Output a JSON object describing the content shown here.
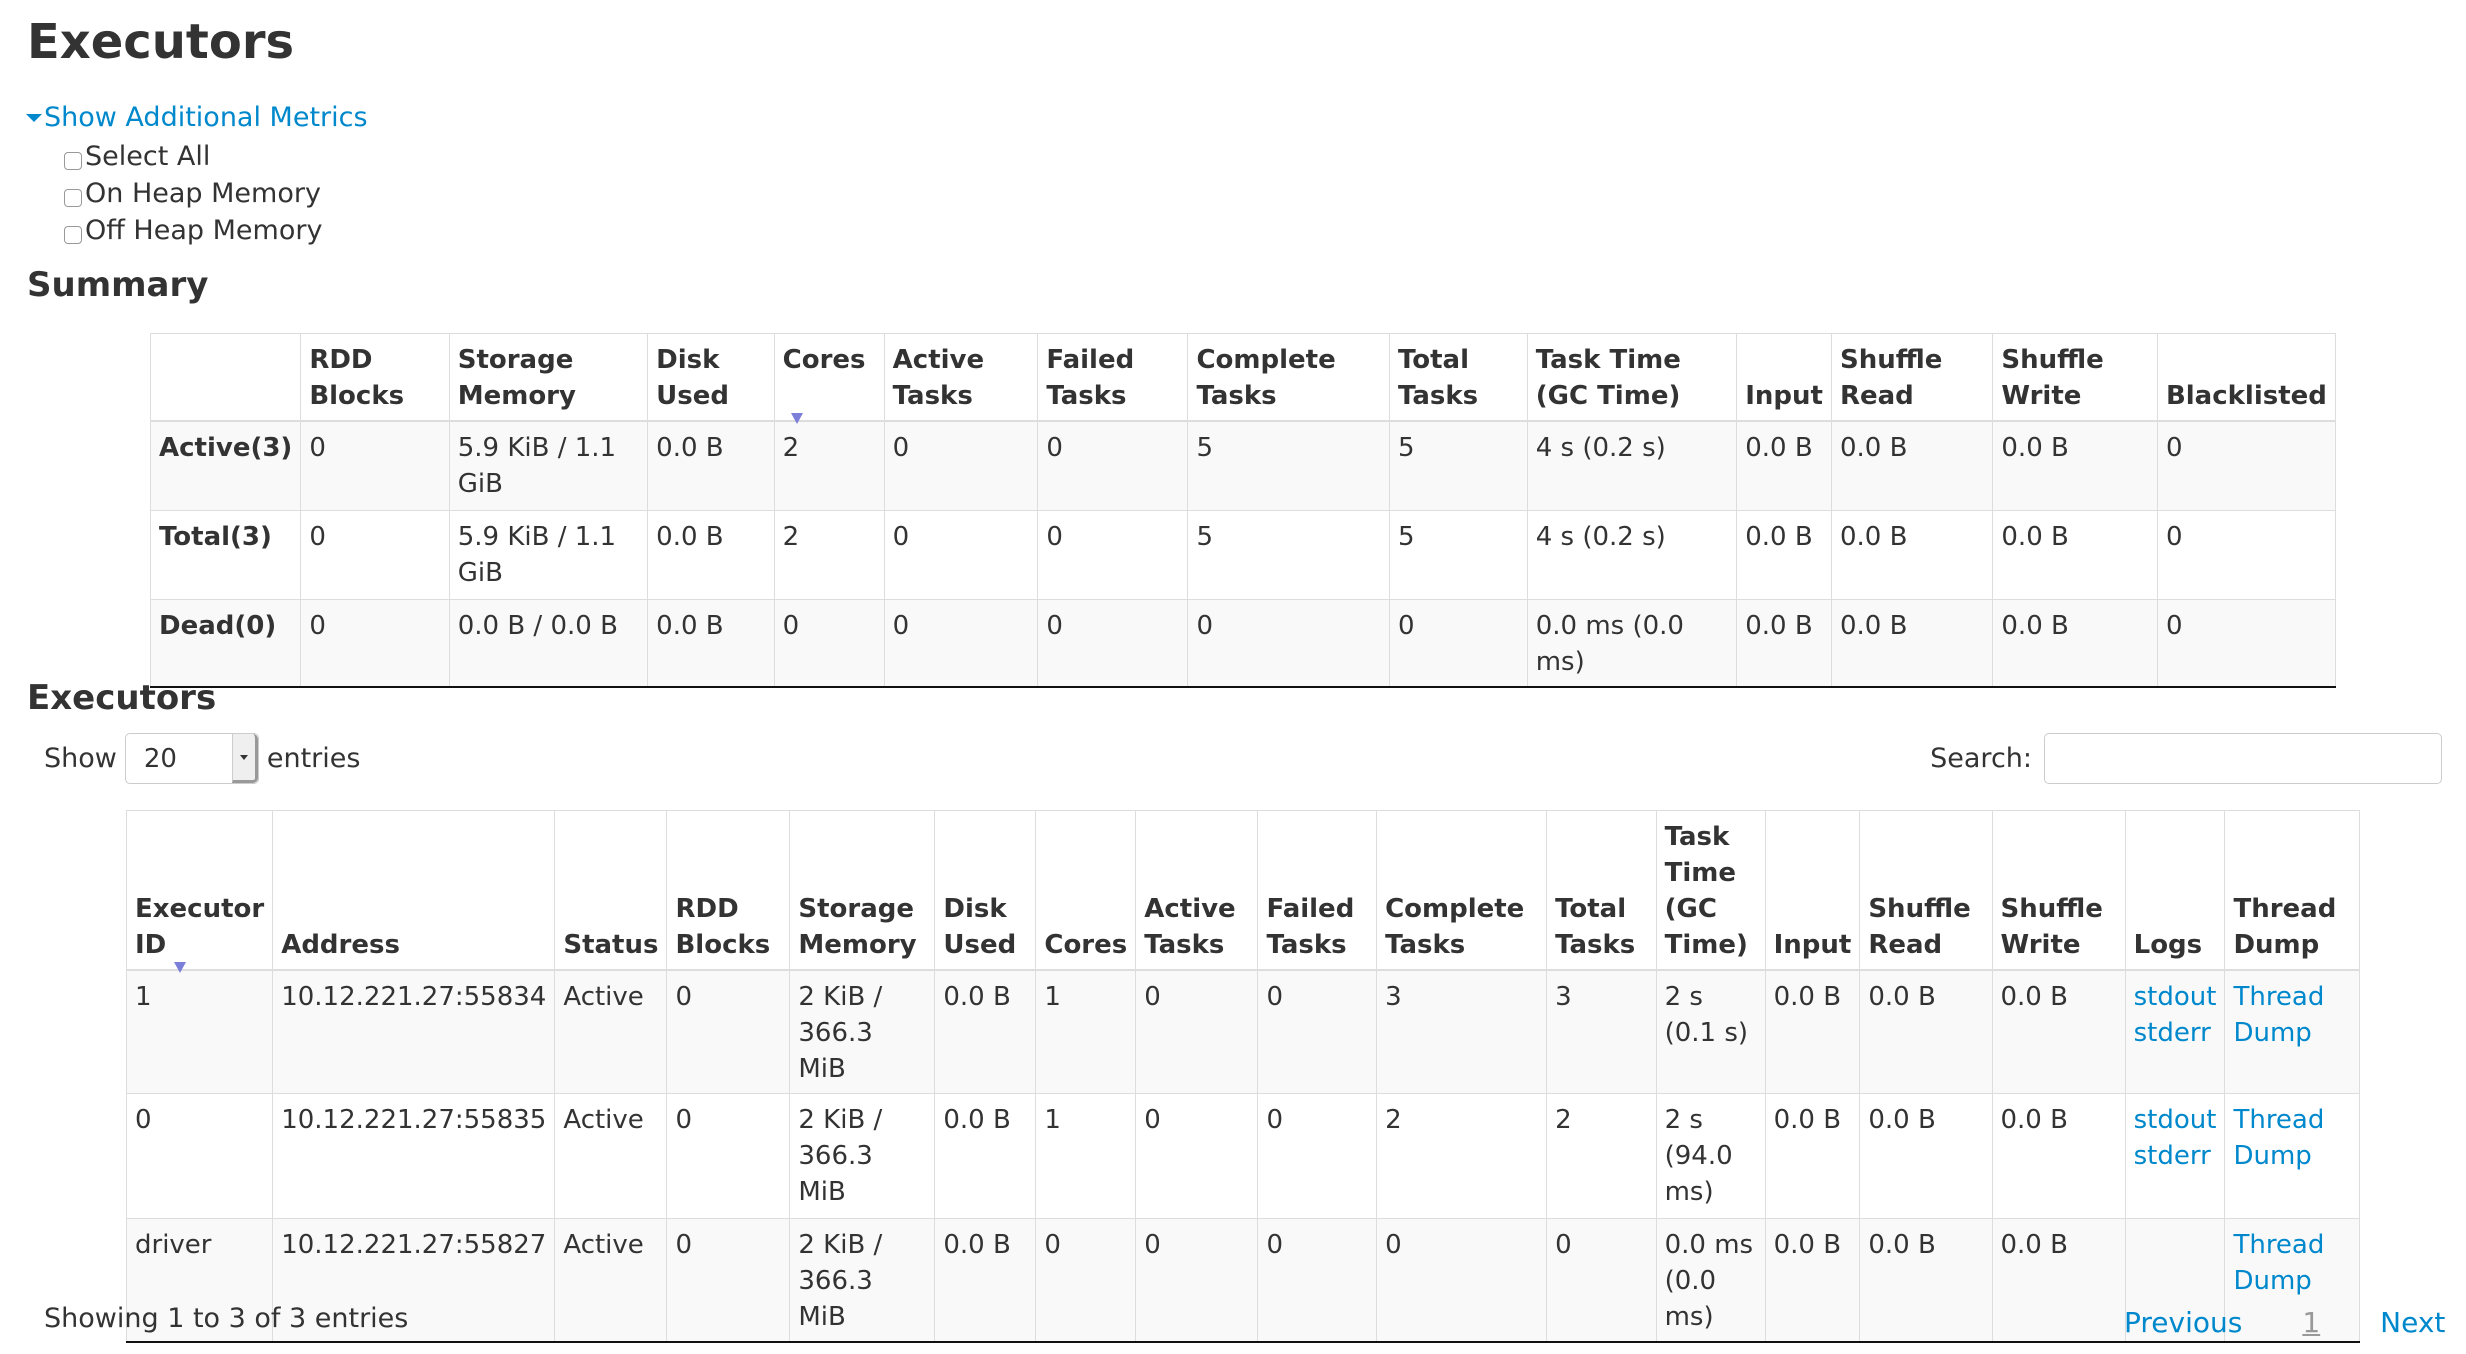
{
  "page_title": "Executors",
  "additional_metrics": {
    "toggle_label": "Show Additional Metrics",
    "options": [
      {
        "label": "Select All",
        "checked": false
      },
      {
        "label": "On Heap Memory",
        "checked": false
      },
      {
        "label": "Off Heap Memory",
        "checked": false
      }
    ]
  },
  "summary": {
    "title": "Summary",
    "columns": [
      "",
      "RDD Blocks",
      "Storage Memory",
      "Disk Used",
      "Cores",
      "Active Tasks",
      "Failed Tasks",
      "Complete Tasks",
      "Total Tasks",
      "Task Time (GC Time)",
      "Input",
      "Shuffle Read",
      "Shuffle Write",
      "Blacklisted"
    ],
    "sorted_column": "Cores",
    "rows": [
      [
        "Active(3)",
        "0",
        "5.9 KiB / 1.1 GiB",
        "0.0 B",
        "2",
        "0",
        "0",
        "5",
        "5",
        "4 s (0.2 s)",
        "0.0 B",
        "0.0 B",
        "0.0 B",
        "0"
      ],
      [
        "Total(3)",
        "0",
        "5.9 KiB / 1.1 GiB",
        "0.0 B",
        "2",
        "0",
        "0",
        "5",
        "5",
        "4 s (0.2 s)",
        "0.0 B",
        "0.0 B",
        "0.0 B",
        "0"
      ],
      [
        "Dead(0)",
        "0",
        "0.0 B / 0.0 B",
        "0.0 B",
        "0",
        "0",
        "0",
        "0",
        "0",
        "0.0 ms (0.0 ms)",
        "0.0 B",
        "0.0 B",
        "0.0 B",
        "0"
      ]
    ]
  },
  "executors": {
    "title": "Executors",
    "length_control": {
      "show_label": "Show",
      "value": "20",
      "entries_label": "entries"
    },
    "search": {
      "label": "Search:",
      "value": "",
      "placeholder": ""
    },
    "columns": [
      "Executor ID",
      "Address",
      "Status",
      "RDD Blocks",
      "Storage Memory",
      "Disk Used",
      "Cores",
      "Active Tasks",
      "Failed Tasks",
      "Complete Tasks",
      "Total Tasks",
      "Task Time (GC Time)",
      "Input",
      "Shuffle Read",
      "Shuffle Write",
      "Logs",
      "Thread Dump"
    ],
    "sorted_column": "Executor ID",
    "rows": [
      {
        "id": "1",
        "address": "10.12.221.27:55834",
        "status": "Active",
        "rdd_blocks": "0",
        "storage_memory": "2 KiB / 366.3 MiB",
        "disk_used": "0.0 B",
        "cores": "1",
        "active_tasks": "0",
        "failed_tasks": "0",
        "complete_tasks": "3",
        "total_tasks": "3",
        "task_time": "2 s (0.1 s)",
        "input": "0.0 B",
        "shuffle_read": "0.0 B",
        "shuffle_write": "0.0 B",
        "logs": [
          "stdout",
          "stderr"
        ],
        "thread_dump": "Thread Dump"
      },
      {
        "id": "0",
        "address": "10.12.221.27:55835",
        "status": "Active",
        "rdd_blocks": "0",
        "storage_memory": "2 KiB / 366.3 MiB",
        "disk_used": "0.0 B",
        "cores": "1",
        "active_tasks": "0",
        "failed_tasks": "0",
        "complete_tasks": "2",
        "total_tasks": "2",
        "task_time": "2 s (94.0 ms)",
        "input": "0.0 B",
        "shuffle_read": "0.0 B",
        "shuffle_write": "0.0 B",
        "logs": [
          "stdout",
          "stderr"
        ],
        "thread_dump": "Thread Dump"
      },
      {
        "id": "driver",
        "address": "10.12.221.27:55827",
        "status": "Active",
        "rdd_blocks": "0",
        "storage_memory": "2 KiB / 366.3 MiB",
        "disk_used": "0.0 B",
        "cores": "0",
        "active_tasks": "0",
        "failed_tasks": "0",
        "complete_tasks": "0",
        "total_tasks": "0",
        "task_time": "0.0 ms (0.0 ms)",
        "input": "0.0 B",
        "shuffle_read": "0.0 B",
        "shuffle_write": "0.0 B",
        "logs": [],
        "thread_dump": "Thread Dump"
      }
    ],
    "info": "Showing 1 to 3 of 3 entries",
    "pagination": {
      "previous": "Previous",
      "current_page": "1",
      "next": "Next"
    }
  },
  "colors": {
    "link": "#0088cc",
    "sort_arrow": "#7b7fd8",
    "stripe": "#f9f9f9"
  }
}
